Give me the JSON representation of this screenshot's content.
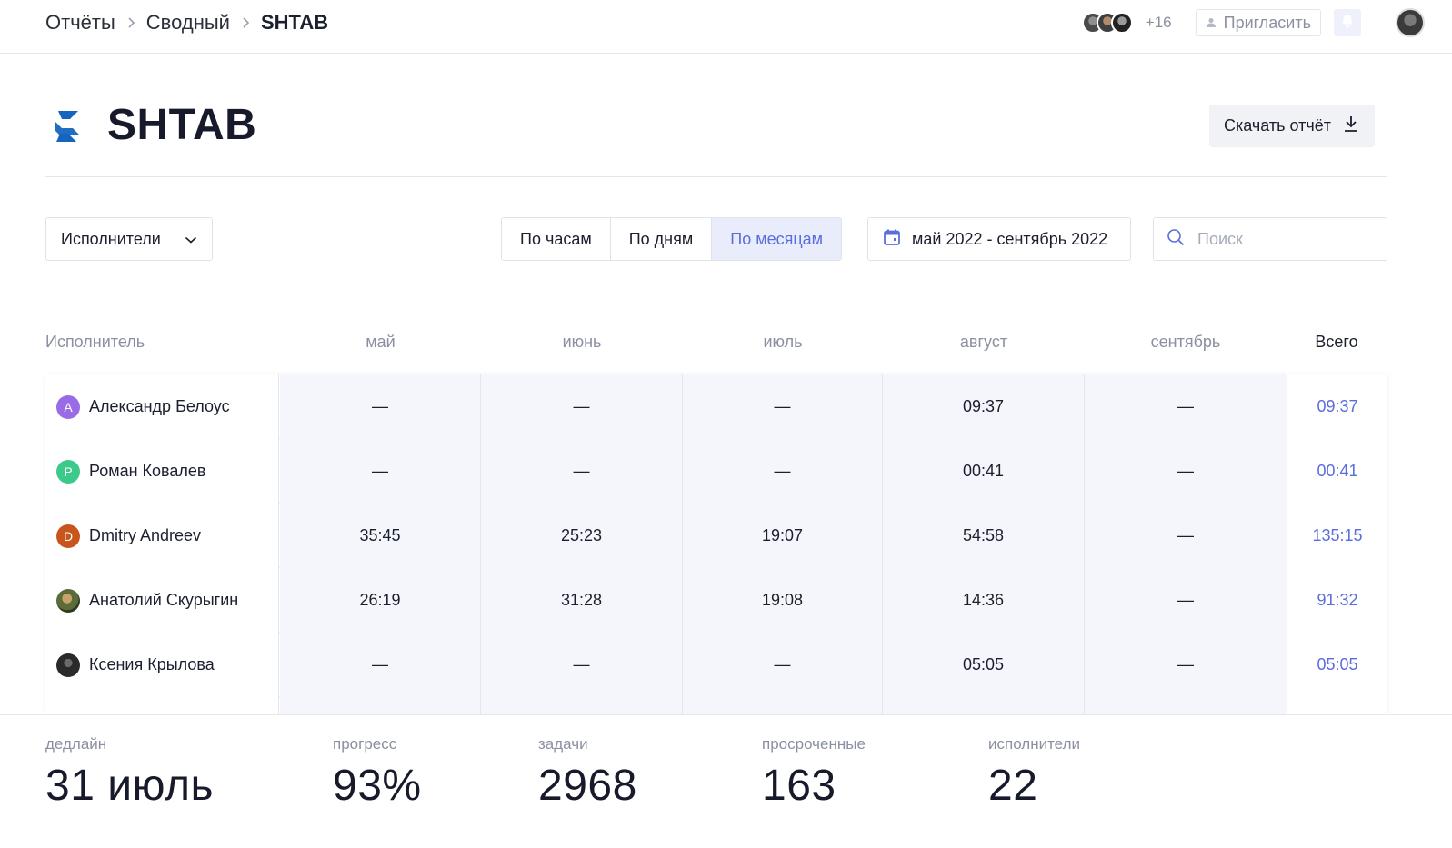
{
  "breadcrumb": [
    "Отчёты",
    "Сводный",
    "SHTAB"
  ],
  "topbar": {
    "extra_members": "+16",
    "invite_label": "Пригласить"
  },
  "project": {
    "title": "SHTAB",
    "download_label": "Скачать отчёт"
  },
  "filters": {
    "group_by": "Исполнители",
    "periods": [
      "По часам",
      "По дням",
      "По месяцам"
    ],
    "active_period": "По месяцам",
    "date_range": "май 2022 - сентябрь 2022",
    "search_placeholder": "Поиск"
  },
  "table": {
    "columns": [
      "Исполнитель",
      "май",
      "июнь",
      "июль",
      "август",
      "сентябрь",
      "Всего"
    ],
    "rows": [
      {
        "name": "Александр Белоус",
        "avatar_letter": "А",
        "avatar_color": "#9b6be6",
        "values": [
          "—",
          "—",
          "—",
          "09:37",
          "—"
        ],
        "total": "09:37"
      },
      {
        "name": "Роман Ковалев",
        "avatar_letter": "Р",
        "avatar_color": "#3dc98a",
        "values": [
          "—",
          "—",
          "—",
          "00:41",
          "—"
        ],
        "total": "00:41"
      },
      {
        "name": "Dmitry Andreev",
        "avatar_letter": "D",
        "avatar_color": "#c8561c",
        "values": [
          "35:45",
          "25:23",
          "19:07",
          "54:58",
          "—"
        ],
        "total": "135:15"
      },
      {
        "name": "Анатолий Скурыгин",
        "avatar_letter": "",
        "avatar_color": "#5b6b3a",
        "values": [
          "26:19",
          "31:28",
          "19:08",
          "14:36",
          "—"
        ],
        "total": "91:32"
      },
      {
        "name": "Ксения Крылова",
        "avatar_letter": "",
        "avatar_color": "#2a2a2a",
        "values": [
          "—",
          "—",
          "—",
          "05:05",
          "—"
        ],
        "total": "05:05"
      }
    ]
  },
  "stats": [
    {
      "label": "дедлайн",
      "value": "31 июль"
    },
    {
      "label": "прогресс",
      "value": "93%"
    },
    {
      "label": "задачи",
      "value": "2968"
    },
    {
      "label": "просроченные",
      "value": "163"
    },
    {
      "label": "исполнители",
      "value": "22"
    }
  ],
  "colors": {
    "accent": "#5a6dde",
    "logo": "#1565c0",
    "cell_bg": "#f4f6fb"
  }
}
